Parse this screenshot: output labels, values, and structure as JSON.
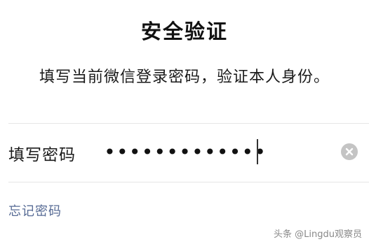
{
  "dialog": {
    "title": "安全验证",
    "subtitle": "填写当前微信登录密码，验证本人身份。"
  },
  "password_field": {
    "label": "填写密码",
    "value": "•••••••••••••",
    "clear_icon": "clear-circle-icon"
  },
  "links": {
    "forgot_password": "忘记密码"
  },
  "watermark": "头条 @Lingdu观察员",
  "colors": {
    "link": "#576b95",
    "clear_button": "#c4c4c4",
    "divider": "#e6e6e6"
  }
}
